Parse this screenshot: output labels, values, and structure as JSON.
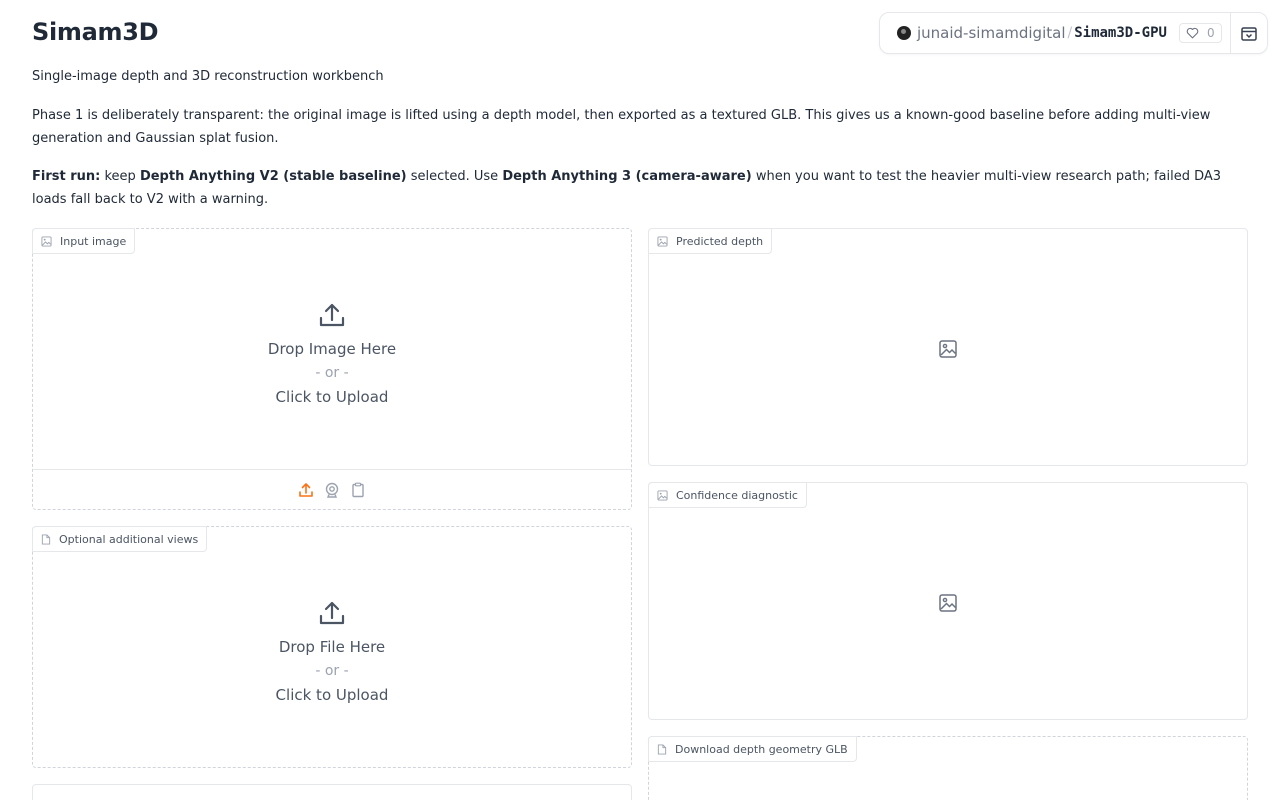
{
  "app": {
    "title": "Simam3D",
    "subtitle": "Single-image depth and 3D reconstruction workbench"
  },
  "hf_badge": {
    "owner": "junaid-simamdigital",
    "separator": "/",
    "repo": "Simam3D-GPU",
    "likes": "0"
  },
  "description": {
    "phase1": "Phase 1 is deliberately transparent: the original image is lifted using a depth model, then exported as a textured GLB. This gives us a known-good baseline before adding multi-view generation and Gaussian splat fusion.",
    "first_run_label": "First run:",
    "first_run_a": " keep ",
    "model_v2": "Depth Anything V2 (stable baseline)",
    "first_run_b": " selected. Use ",
    "model_v3": "Depth Anything 3 (camera-aware)",
    "first_run_c": " when you want to test the heavier multi-view research path; failed DA3 loads fall back to V2 with a warning."
  },
  "input_image": {
    "label": "Input image",
    "drop_text": "Drop Image Here",
    "or_text": "- or -",
    "click_text": "Click to Upload"
  },
  "additional_views": {
    "label": "Optional additional views",
    "drop_text": "Drop File Here",
    "or_text": "- or -",
    "click_text": "Click to Upload"
  },
  "predicted_depth": {
    "label": "Predicted depth"
  },
  "confidence": {
    "label": "Confidence diagnostic"
  },
  "download_glb": {
    "label": "Download depth geometry GLB"
  },
  "colors": {
    "accent": "#f97316",
    "text": "#1f2937",
    "muted": "#6b7280",
    "border": "#e5e7eb"
  },
  "icons": {
    "image": "image-icon",
    "file": "file-icon",
    "upload": "upload-icon",
    "webcam": "webcam-icon",
    "clipboard": "clipboard-icon",
    "heart": "heart-icon",
    "collapse": "collapse-icon"
  }
}
